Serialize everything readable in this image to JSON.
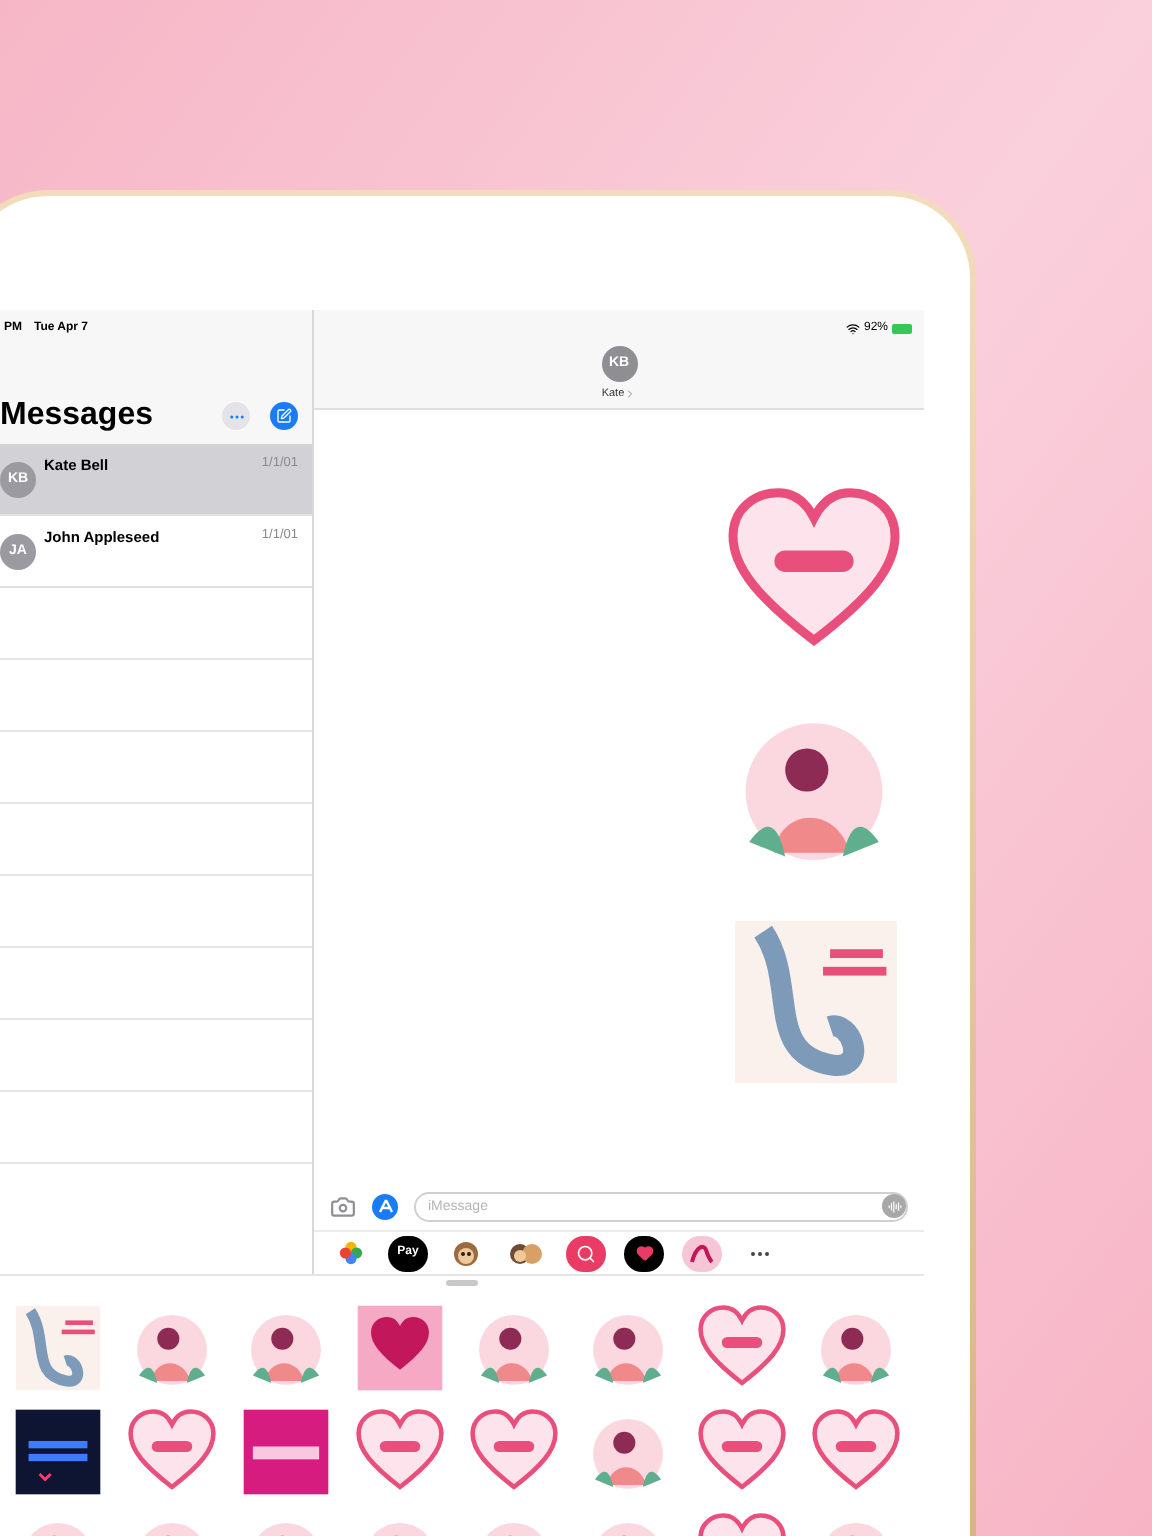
{
  "status_bar": {
    "time": "PM",
    "date": "Tue Apr 7",
    "battery": "92%"
  },
  "sidebar": {
    "title": "Messages",
    "conversations": [
      {
        "initials": "KB",
        "name": "Kate Bell",
        "date": "1/1/01",
        "selected": true
      },
      {
        "initials": "JA",
        "name": "John Appleseed",
        "date": "1/1/01",
        "selected": false
      }
    ]
  },
  "conversation": {
    "initials": "KB",
    "name": "Kate",
    "stickers": [
      {
        "kind": "heart"
      },
      {
        "kind": "round"
      },
      {
        "kind": "light-square"
      }
    ]
  },
  "composer": {
    "placeholder": "iMessage"
  },
  "app_drawer": [
    {
      "kind": "photos",
      "selected": false
    },
    {
      "kind": "pay",
      "label": "Pay",
      "selected": false
    },
    {
      "kind": "monkey",
      "selected": false
    },
    {
      "kind": "memoji",
      "selected": false
    },
    {
      "kind": "search",
      "selected": false
    },
    {
      "kind": "heart",
      "selected": false
    },
    {
      "kind": "sticker",
      "selected": true
    },
    {
      "kind": "more",
      "selected": false
    }
  ],
  "sticker_grid": [
    {
      "kind": "light-square"
    },
    {
      "kind": "round"
    },
    {
      "kind": "round"
    },
    {
      "kind": "pink-square"
    },
    {
      "kind": "round"
    },
    {
      "kind": "round"
    },
    {
      "kind": "heart"
    },
    {
      "kind": "round"
    },
    {
      "kind": "dark"
    },
    {
      "kind": "heart"
    },
    {
      "kind": "magenta"
    },
    {
      "kind": "heart"
    },
    {
      "kind": "heart"
    },
    {
      "kind": "round"
    },
    {
      "kind": "heart"
    },
    {
      "kind": "heart"
    },
    {
      "kind": "round"
    },
    {
      "kind": "round"
    },
    {
      "kind": "round"
    },
    {
      "kind": "round"
    },
    {
      "kind": "round"
    },
    {
      "kind": "round"
    },
    {
      "kind": "heart"
    },
    {
      "kind": "round"
    }
  ]
}
